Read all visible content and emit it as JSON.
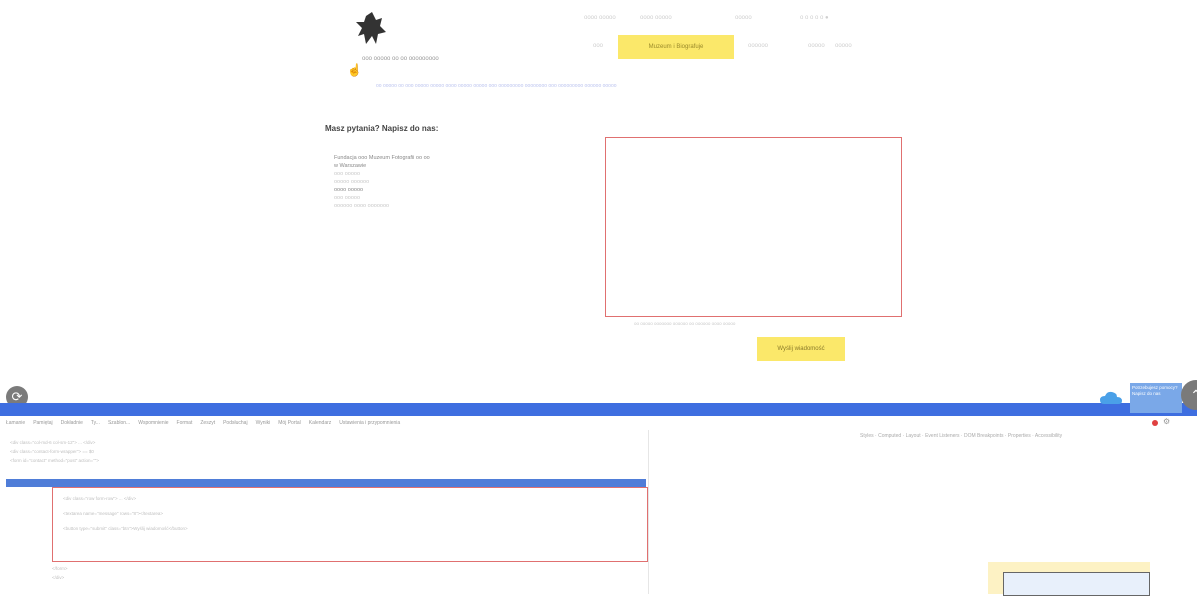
{
  "site": {
    "logo_name": "pegasus-logo",
    "top_links": [
      "",
      "",
      "",
      ""
    ],
    "menu": {
      "active_label": "Muzeum i Biografuje",
      "items": [
        "",
        "",
        "",
        ""
      ]
    },
    "subtitle": "ooo ooooo oo oo ooooooooo",
    "info_line": "oo ooooo oo ooo ooooo ooooo oooo ooooo ooooo ooo ooooooooo oooooooo ooo ooooooooo oooooo ooooo",
    "contact_heading": "Masz pytania? Napisz do nas:",
    "contact_lines": [
      "Fundacja ooo Muzeum Fotografii oo oo",
      "w Warszawie",
      "ooo ooooo",
      "ooooo oooooo",
      "oooo ooooo",
      "ooo ooooo",
      "oooooo oooo ooooooo"
    ],
    "form_note": "oo ooooo ooooooo oooooo oo oooooo oooo ooooo",
    "send_button": "Wyślij wiadomość",
    "chat_widget_text": "Potrzebujesz pomocy? Napisz do nas"
  },
  "devtools": {
    "bookmarks": [
      "Łamanie",
      "Pamiętaj",
      "Dokładnie",
      "Ty...",
      "Szablon...",
      "Wspomnienie",
      "Format",
      "Zeszyt",
      "Podsłuchaj",
      "Wyniki",
      "Mój Portal",
      "Kalendarz",
      "Ustawienia i przypomnienia"
    ],
    "right_tabs": [
      "Styles",
      "Computed",
      "Layout",
      "Event Listeners",
      "DOM Breakpoints",
      "Properties",
      "Accessibility"
    ],
    "code_lines": [
      "<div class=\"col-md-6 col-sm-12\"> ... </div>",
      "<div class=\"contact-form-wrapper\"> == $0",
      "<form id=\"contact\" method=\"post\" action=\"\">",
      "<div class=\"row form-row\"> ... </div>",
      "<textarea name=\"message\" rows=\"8\"></textarea>",
      "<button type=\"submit\" class=\"btn\">Wyślij wiadomość</button>",
      "</form>",
      "</div>"
    ]
  },
  "colors": {
    "accent_yellow": "#fbe86a",
    "border_red": "#e07070",
    "taskbar_blue": "#3e6ee0"
  }
}
